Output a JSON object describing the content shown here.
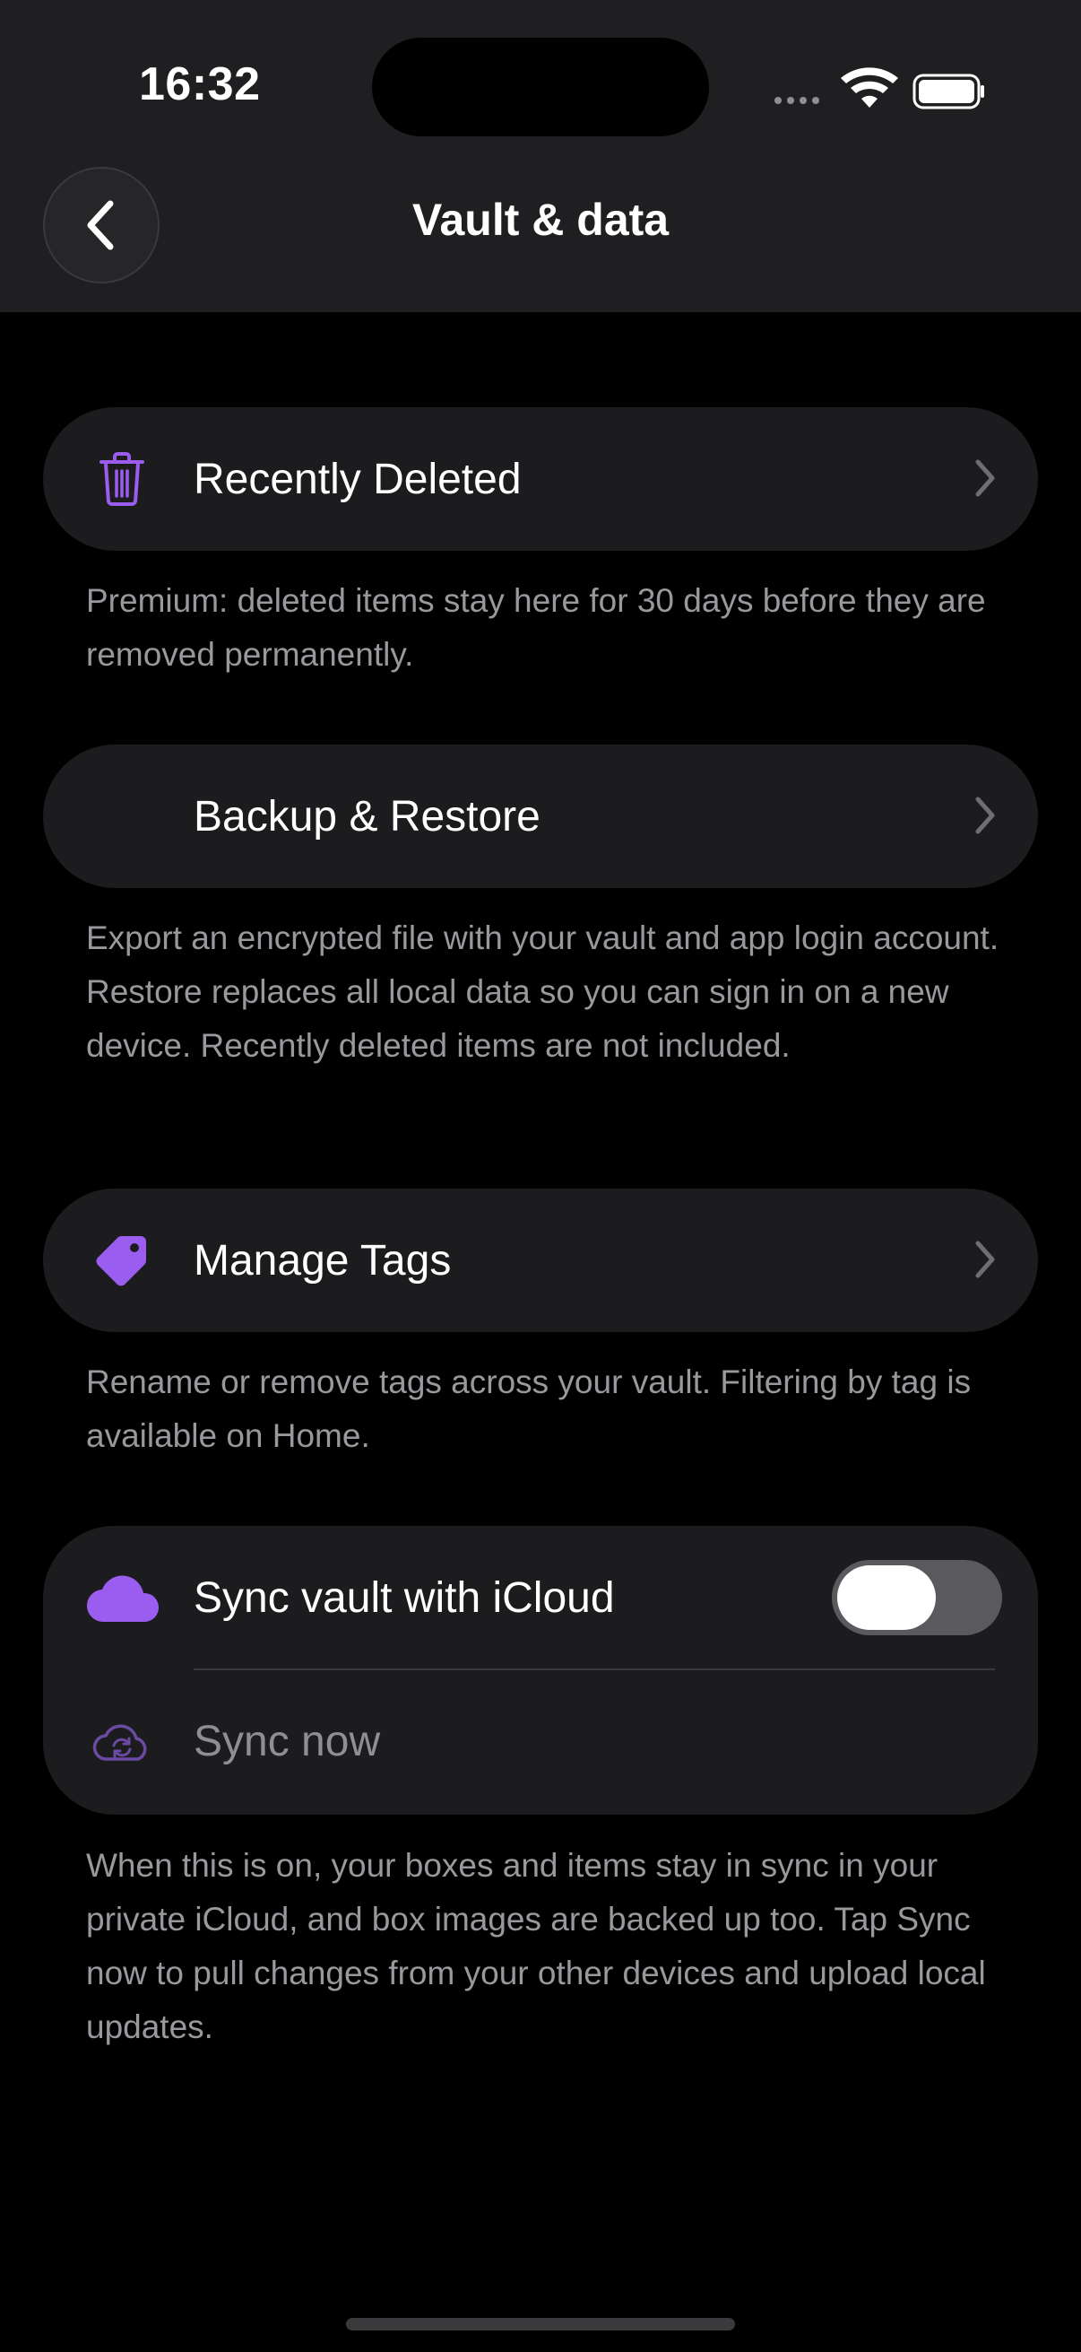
{
  "status_bar": {
    "time": "16:32",
    "icons": [
      "signal-icon",
      "wifi-icon",
      "battery-icon"
    ]
  },
  "nav": {
    "back_icon": "chevron-left-icon",
    "title": "Vault & data"
  },
  "sections": {
    "recently_deleted": {
      "label": "Recently Deleted",
      "icon": "trash-icon",
      "caption": "Premium: deleted items stay here for 30 days before they are removed permanently."
    },
    "backup_restore": {
      "label": "Backup & Restore",
      "caption": "Export an encrypted file with your vault and app login account. Restore replaces all local data so you can sign in on a new device. Recently deleted items are not included."
    },
    "manage_tags": {
      "label": "Manage Tags",
      "icon": "tag-icon",
      "caption": "Rename or remove tags across your vault. Filtering by tag is available on Home."
    },
    "icloud": {
      "sync_label": "Sync vault with iCloud",
      "sync_icon": "cloud-icon",
      "sync_enabled": false,
      "sync_now_label": "Sync now",
      "sync_now_icon": "cloud-sync-icon",
      "caption": "When this is on, your boxes and items stay in sync in your private iCloud, and box images are backed up too. Tap Sync now to pull changes from your other devices and upload local updates."
    }
  },
  "colors": {
    "accent": "#9b5cf0",
    "background": "#000000",
    "card": "#1c1c1e",
    "nav_bar": "#1f1f21",
    "caption_text": "#98989d"
  }
}
